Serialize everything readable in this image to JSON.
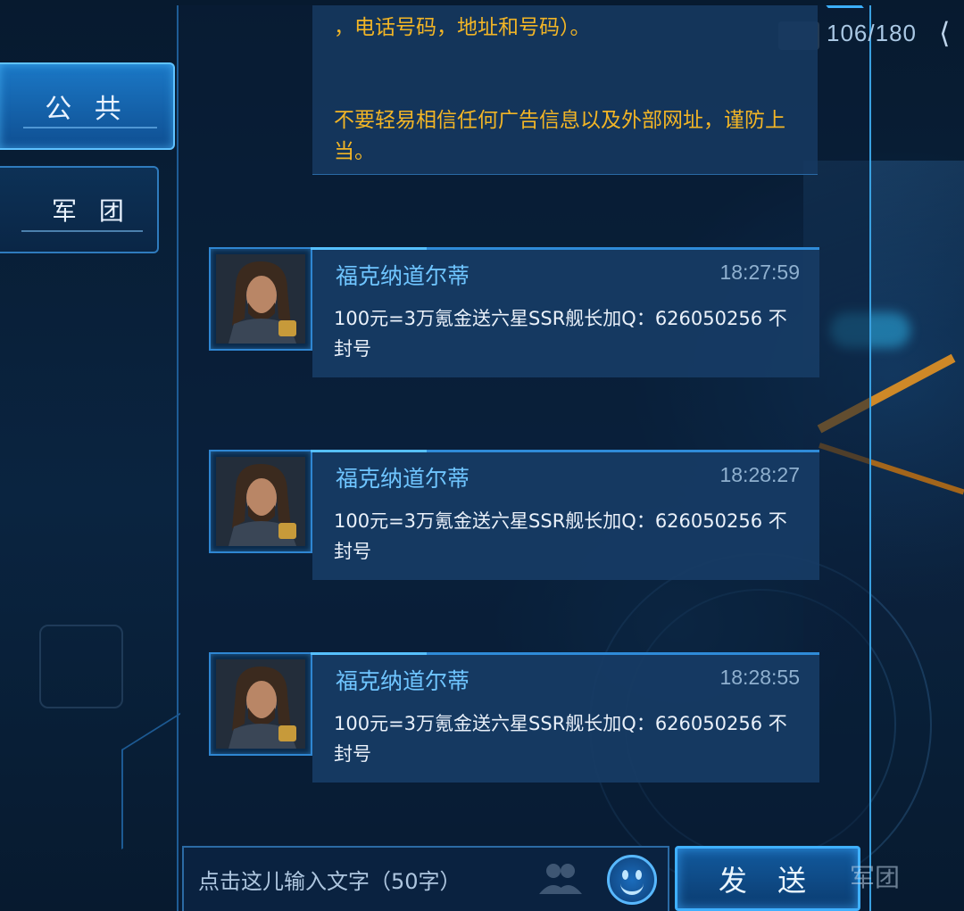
{
  "tabs": [
    {
      "label": "公 共",
      "active": true
    },
    {
      "label": "军 团",
      "active": false
    }
  ],
  "counter": "106/180",
  "system_message": {
    "line1": "，电话号码，地址和号码）。",
    "line2": "不要轻易相信任何广告信息以及外部网址，谨防上当。",
    "color": "#f2b526"
  },
  "messages": [
    {
      "sender": "福克纳道尔蒂",
      "time": "18:27:59",
      "text": "100元=3万氪金送六星SSR舰长加Q：626050256 不封号"
    },
    {
      "sender": "福克纳道尔蒂",
      "time": "18:28:27",
      "text": "100元=3万氪金送六星SSR舰长加Q：626050256 不封号"
    },
    {
      "sender": "福克纳道尔蒂",
      "time": "18:28:55",
      "text": "100元=3万氪金送六星SSR舰长加Q：626050256 不封号"
    }
  ],
  "input": {
    "placeholder": "点击这儿输入文字（50字）"
  },
  "send_label": "发 送",
  "bottom_tab_label": "军团",
  "icons": {
    "emoji": "smiley-face-icon",
    "friends": "friends-icon",
    "back": "back-arrow-icon",
    "avatar": "captain-portrait"
  },
  "colors": {
    "accent": "#3fb0ff",
    "sender": "#6fc5ff",
    "panel": "#173c65"
  }
}
